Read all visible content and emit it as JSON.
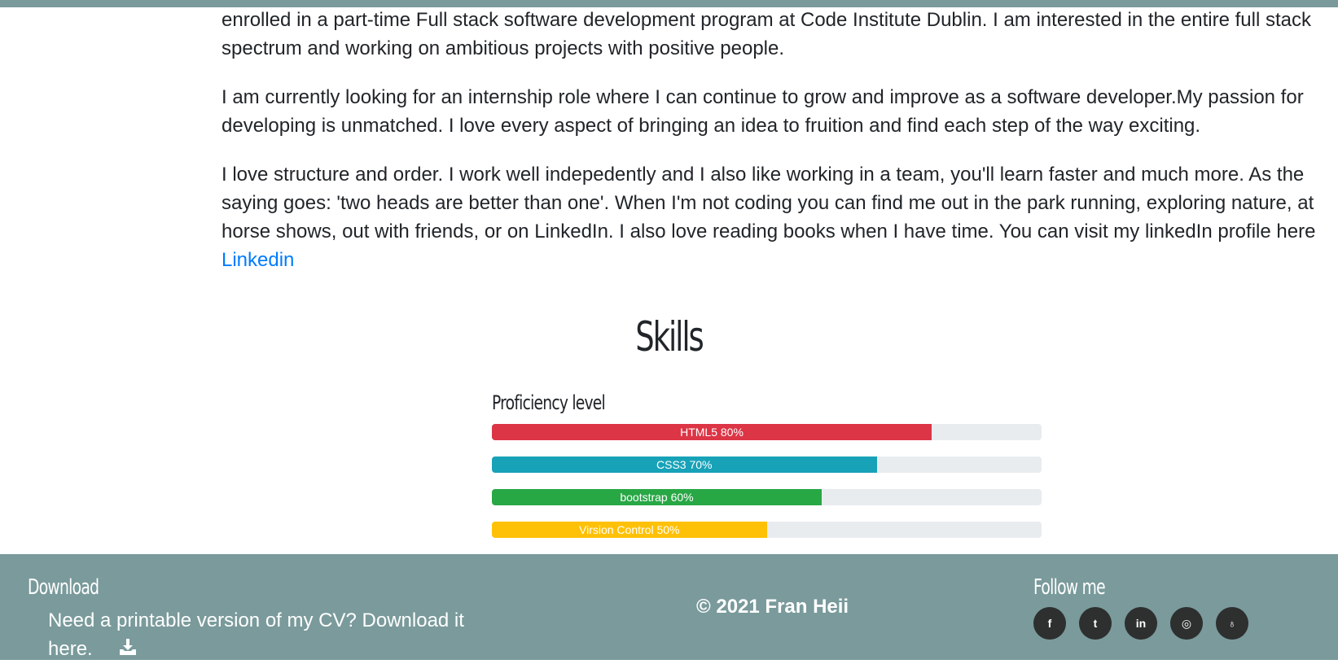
{
  "about": {
    "p1": "enrolled in a part-time Full stack software development program at Code Institute Dublin. I am interested in the entire full stack spectrum and working on ambitious projects with positive people.",
    "p2": "I am currently looking for an internship role where I can continue to grow and improve as a software developer.My passion for developing is unmatched. I love every aspect of bringing an idea to fruition and find each step of the way exciting.",
    "p3_text": "I love structure and order. I work well indepedently and I also like working in a team, you'll learn faster and much more. As the saying goes: 'two heads are better than one'. When I'm not coding you can find me out in the park running, exploring nature, at horse shows, out with friends, or on LinkedIn. I also love reading books when I have time. You can visit my linkedIn profile here ",
    "p3_link": "Linkedin"
  },
  "skills": {
    "title": "Skills",
    "subtitle": "Proficiency level",
    "bars": [
      {
        "label": "HTML5 80%",
        "value": 80,
        "color": "#dc3545"
      },
      {
        "label": "CSS3 70%",
        "value": 70,
        "color": "#17a2b8"
      },
      {
        "label": "bootstrap 60%",
        "value": 60,
        "color": "#28a745"
      },
      {
        "label": "Virsion Control 50%",
        "value": 50,
        "color": "#ffc107"
      }
    ]
  },
  "footer": {
    "download_heading": "Download",
    "download_text": "Need a printable version of my CV? Download it here.",
    "copyright": "© 2021 Fran Heii",
    "follow_heading": "Follow me",
    "social": [
      {
        "icon": "facebook-icon",
        "glyph": "f"
      },
      {
        "icon": "twitter-icon",
        "glyph": "t"
      },
      {
        "icon": "linkedin-icon",
        "glyph": "in"
      },
      {
        "icon": "instagram-icon",
        "glyph": "◎"
      },
      {
        "icon": "github-icon",
        "glyph": "♁"
      }
    ],
    "bg_color": "#7a9a9b"
  }
}
